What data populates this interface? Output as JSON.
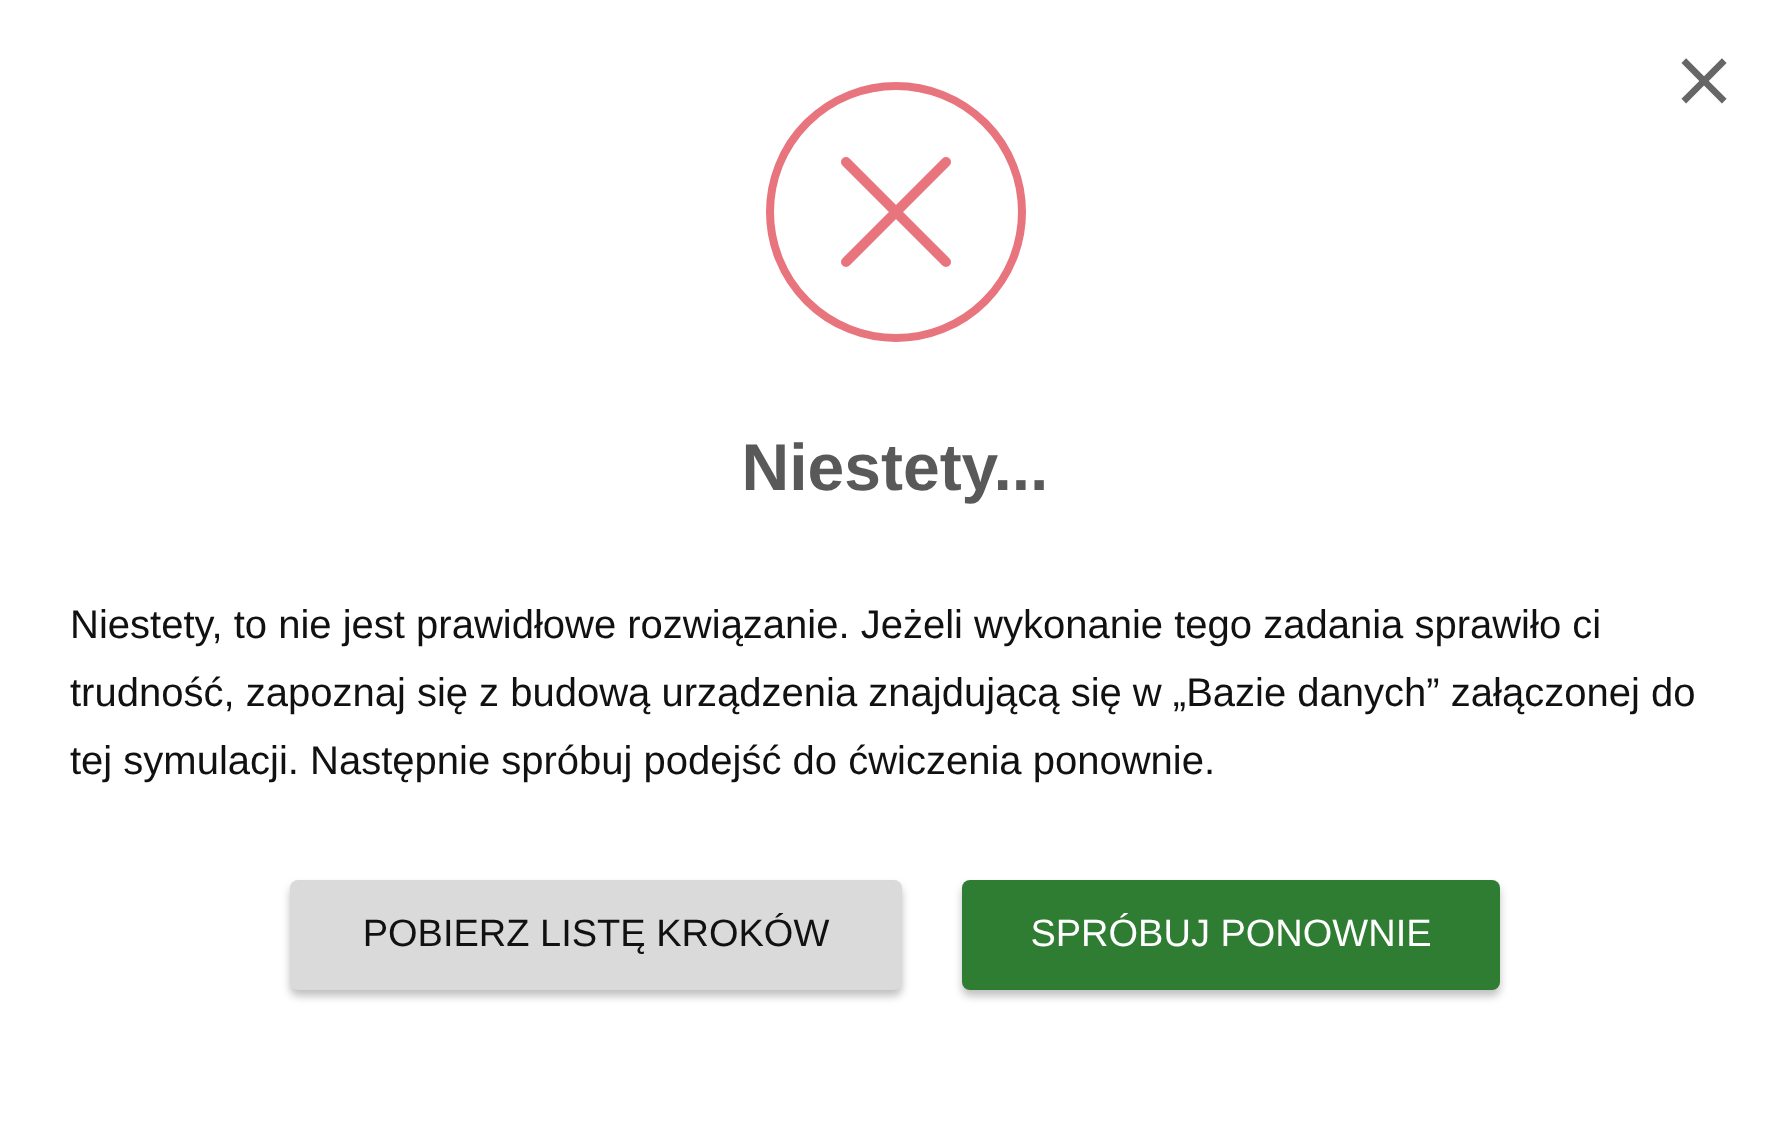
{
  "dialog": {
    "close": "×",
    "icon": {
      "kind": "error"
    },
    "title": "Niestety...",
    "message": "Niestety, to nie jest prawidłowe rozwiązanie. Jeżeli wykonanie tego zadania sprawiło ci trudność, zapoznaj się z budową urządzenia znajdującą się w „Bazie danych” załączonej do tej symulacji. Następnie spróbuj podejść do ćwiczenia ponownie.",
    "buttons": [
      {
        "label": "POBIERZ LISTĘ KROKÓW",
        "kind": "secondary"
      },
      {
        "label": "SPRÓBUJ PONOWNIE",
        "kind": "primary"
      }
    ]
  }
}
